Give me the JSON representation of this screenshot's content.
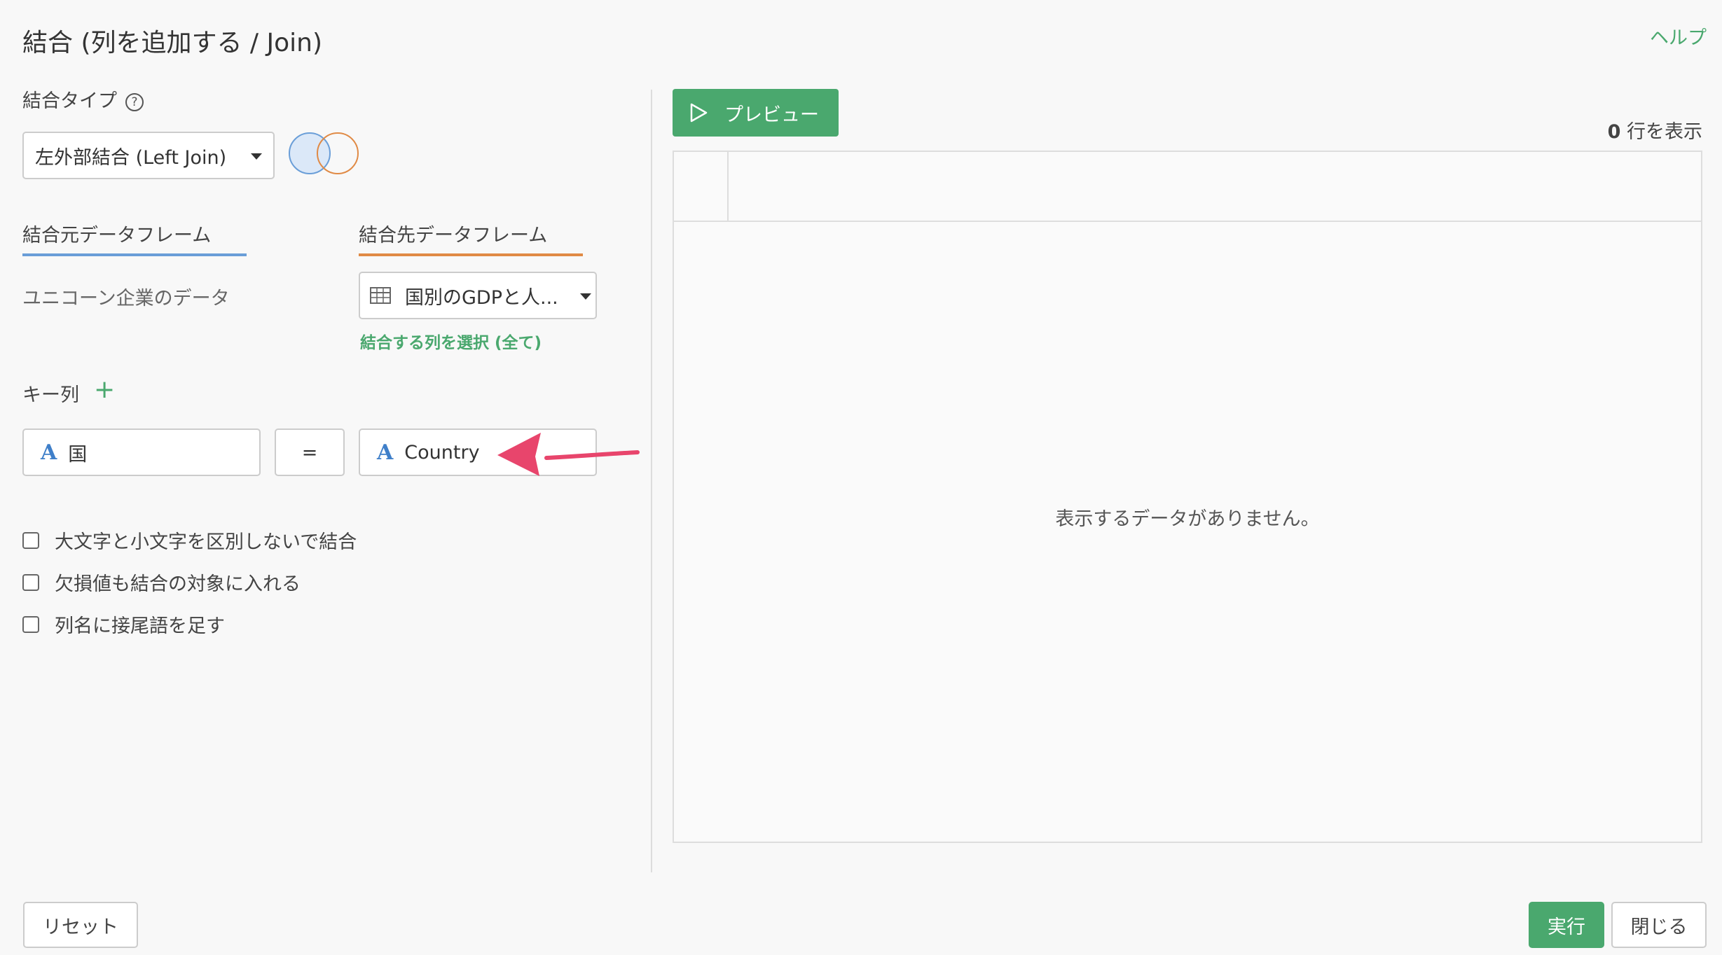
{
  "header": {
    "title": "結合 (列を追加する / Join)",
    "help": "ヘルプ"
  },
  "join_type": {
    "label": "結合タイプ",
    "selected": "左外部結合 (Left Join)",
    "venn_colors": {
      "left": "#6a9ed8",
      "right": "#e08a45"
    }
  },
  "source": {
    "tab_label": "結合元データフレーム",
    "name": "ユニコーン企業のデータ",
    "accent": "#6a9ed8"
  },
  "target": {
    "tab_label": "結合先データフレーム",
    "selected": "国別のGDPと人...",
    "select_columns": "結合する列を選択 (全て)",
    "accent": "#e08a45"
  },
  "key": {
    "label": "キー列",
    "add": "+",
    "left_col": "国",
    "equals": "=",
    "right_col": "Country"
  },
  "options": [
    {
      "label": "大文字と小文字を区別しないで結合",
      "checked": false
    },
    {
      "label": "欠損値も結合の対象に入れる",
      "checked": false
    },
    {
      "label": "列名に接尾語を足す",
      "checked": false
    }
  ],
  "preview": {
    "button": "プレビュー",
    "row_count": "0",
    "row_suffix": " 行を表示",
    "empty_message": "表示するデータがありません。"
  },
  "footer": {
    "reset": "リセット",
    "run": "実行",
    "close": "閉じる"
  },
  "colors": {
    "accent_green": "#4aa86e",
    "arrow": "#e8456c"
  }
}
